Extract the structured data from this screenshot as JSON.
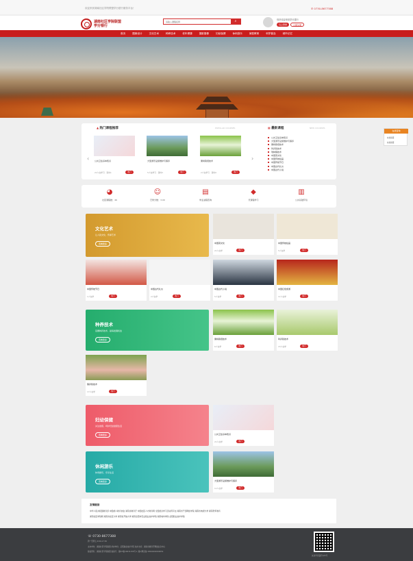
{
  "topbar": {
    "welcome": "欢迎来到湖南社区学院联盟学分银行服务平台！",
    "phone": "0730-8677388"
  },
  "logo": {
    "name_line1": "湖南社区学院联盟",
    "name_line2": "学分银行"
  },
  "search": {
    "placeholder": "请输入课程名称"
  },
  "user": {
    "hello": "你好欢迎来到学分银行",
    "login": "马上登录",
    "register": "立即注册"
  },
  "nav": [
    "首页",
    "图案设计",
    "文化艺术",
    "种养技术",
    "老年健康",
    "摄影摄像",
    "妇幼保健",
    "休闲游乐",
    "家庭教育",
    "科学普及",
    "城市记忆"
  ],
  "hot": {
    "title": "热门课程推荐",
    "sub": "POPULAR COURSES",
    "items": [
      {
        "name": "公共卫生基本知识",
        "meta": "21人在学习 · 课时1",
        "tag": "热门"
      },
      {
        "name": "大型游乐设施维护与保养",
        "meta": "5人在学习 · 课时5",
        "tag": "热门"
      },
      {
        "name": "果树栽培技术",
        "meta": "2人在学习 · 课时6",
        "tag": "热门"
      }
    ]
  },
  "new": {
    "title": "最新课程",
    "sub": "NEW COURSES",
    "items": [
      "公共卫生基本知识",
      "大型游乐设施维护与保养",
      "果树栽培技术",
      "鸡养殖技术",
      "瑞种猪技术",
      "中国茶文化",
      "中国传统绘画",
      "中国传统节日",
      "中国古代礼仪",
      "中国古代小说"
    ]
  },
  "stats": [
    {
      "icon": "pie-chart-icon",
      "label": "社区课程数：46"
    },
    {
      "icon": "person-icon",
      "label": "已修分数：3.00"
    },
    {
      "icon": "document-icon",
      "label": "学业进程查询"
    },
    {
      "icon": "box-icon",
      "label": "凭课程学习"
    },
    {
      "icon": "book-icon",
      "label": "公共基础环境"
    }
  ],
  "side": {
    "title": "在线咨询",
    "line1": "在线客服",
    "line2": "在线客服"
  },
  "sections": [
    {
      "banner_title": "文化艺术",
      "banner_sub": "让人民文化，传承艺术",
      "banner_button": "查看更多",
      "banner_color": "#d8a536",
      "courses": [
        {
          "name": "中国茶文化",
          "meta": "21人在学",
          "tag": "热门"
        },
        {
          "name": "中国传统绘画",
          "meta": "5人在学",
          "tag": "热门"
        },
        {
          "name": "中国传统节日",
          "meta": "1人在学",
          "tag": "热门"
        },
        {
          "name": "中国古代礼仪",
          "meta": "2人在学",
          "tag": "热门"
        },
        {
          "name": "中国古代小说",
          "meta": "5人在学",
          "tag": "热门"
        },
        {
          "name": "中国红色旅游",
          "meta": "11人在学",
          "tag": "热门"
        }
      ]
    },
    {
      "banner_title": "种养技术",
      "banner_sub": "掌握种养技术，赢得发展机会",
      "banner_button": "查看更多",
      "banner_color": "#32b978",
      "courses": [
        {
          "name": "果树栽培技术",
          "meta": "6人在学",
          "tag": "热门"
        },
        {
          "name": "鸡养殖技术",
          "meta": "15人在学",
          "tag": "热门"
        },
        {
          "name": "猪养殖技术",
          "meta": "17人在学",
          "tag": "热门"
        }
      ]
    },
    {
      "banner_title": "妇幼保健",
      "banner_sub": "关注健康，呵护妇幼健康生活",
      "banner_button": "查看更多",
      "banner_color": "#ef6773",
      "courses": [
        {
          "name": "公共卫生基本知识",
          "meta": "21人在学",
          "tag": "热门"
        }
      ]
    },
    {
      "banner_title": "休闲游乐",
      "banner_sub": "休闲娱乐，乐享生活",
      "banner_button": "查看更多",
      "banner_color": "#32b5b0",
      "courses": [
        {
          "name": "大型游乐设施维护与保养",
          "meta": "11人在学",
          "tag": "热门"
        }
      ]
    }
  ],
  "links": {
    "title": "友情链接",
    "row1": "中华人民共和国教育部   中国成人教育协会   湖南省教育厅   中国社区人才教育网   全国终身学习活动周平台   湖南省干部网络学院   湖南省电视大学   湖南老年教育",
    "row2": "湖南社区学院网   湖南省社区大学   湖南省开放大学   湖南岳阳市农业职业技术学院   湖南城市学院   岳阳职业技术学院"
  },
  "footer": {
    "tel": "0730-8677388",
    "hours": "周一至周五 9:00-17:30",
    "line1": "主办单位：湖南社区学院联盟   承办单位：岳阳职业技术学院   技术支持：湖南省教育厅网络信息中心",
    "line2": "版权所有：湖南社区学院联盟   备案号：湘ICP备10031158号-1   湘公网安备 43060202000054",
    "qr_caption": "关注学分银行公众号"
  }
}
